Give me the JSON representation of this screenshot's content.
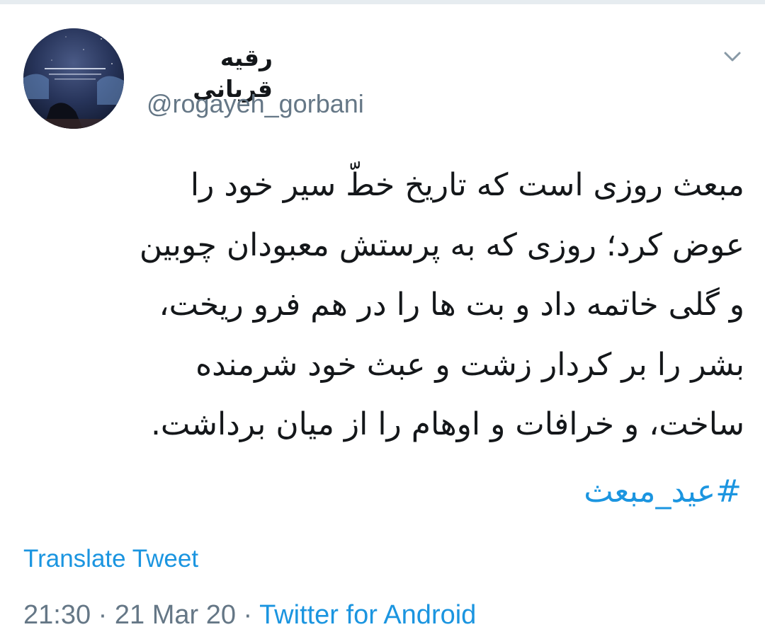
{
  "tweet": {
    "display_name": "رقیه قربانی",
    "handle": "@rogayeh_gorbani",
    "body_lines": [
      "مبعث روزی است که تاریخ خطّ سیر خود را",
      "عوض کرد؛ روزی که به پرستش معبودان چوبین",
      "و گلی خاتمه داد و بت ها را در هم فرو ریخت،",
      "بشر را بر کردار زشت و عبث خود شرمنده",
      "ساخت، و خرافات و اوهام را از میان برداشت."
    ],
    "hashtag": "#عید_مبعث",
    "translate_label": "Translate Tweet",
    "time": "21:30",
    "separator": "·",
    "date": "21 Mar 20",
    "source": "Twitter for Android"
  },
  "icons": {
    "menu": "chevron-down-icon",
    "avatar": "profile-avatar"
  },
  "colors": {
    "text": "#14171a",
    "secondary": "#657786",
    "link": "#1b95e0",
    "divider": "#e6ecf0"
  }
}
